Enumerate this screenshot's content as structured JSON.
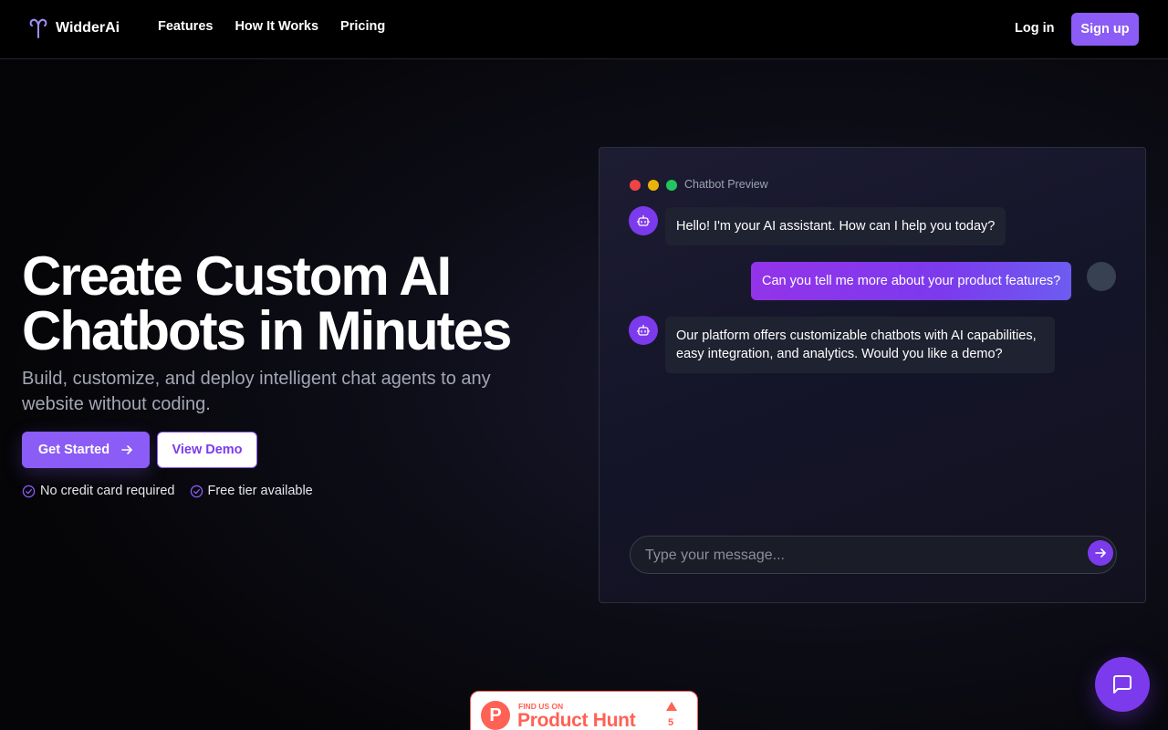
{
  "brand": {
    "name": "WidderAi"
  },
  "nav": {
    "items": [
      {
        "label": "Features"
      },
      {
        "label": "How It Works"
      },
      {
        "label": "Pricing"
      }
    ],
    "login_label": "Log in",
    "signup_label": "Sign up"
  },
  "hero": {
    "title_line1": "Create Custom AI",
    "title_line2": "Chatbots in Minutes",
    "subtitle": "Build, customize, and deploy intelligent chat agents to any website without coding.",
    "primary_cta": "Get Started",
    "secondary_cta": "View Demo",
    "perks": [
      "No credit card required",
      "Free tier available"
    ]
  },
  "preview": {
    "title": "Chatbot Preview",
    "messages": [
      {
        "from": "bot",
        "text": "Hello! I'm your AI assistant. How can I help you today?"
      },
      {
        "from": "user",
        "text": "Can you tell me more about your product features?"
      },
      {
        "from": "bot",
        "text": "Our platform offers customizable chatbots with AI capabilities, easy integration, and analytics. Would you like a demo?"
      }
    ],
    "input_placeholder": "Type your message..."
  },
  "product_hunt": {
    "find_label": "FIND US ON",
    "name": "Product Hunt",
    "upvotes": "5"
  },
  "icons": {
    "logo": "aries-icon",
    "arrow": "arrow-right-icon",
    "check": "check-circle-icon",
    "bot": "bot-icon",
    "send": "send-arrow-icon",
    "chat": "message-square-icon"
  },
  "colors": {
    "accent": "#8b5cf6",
    "accent_dark": "#7c3aed",
    "product_hunt": "#ff6154",
    "window_red": "#ef4444",
    "window_yellow": "#eab308",
    "window_green": "#22c55e"
  }
}
